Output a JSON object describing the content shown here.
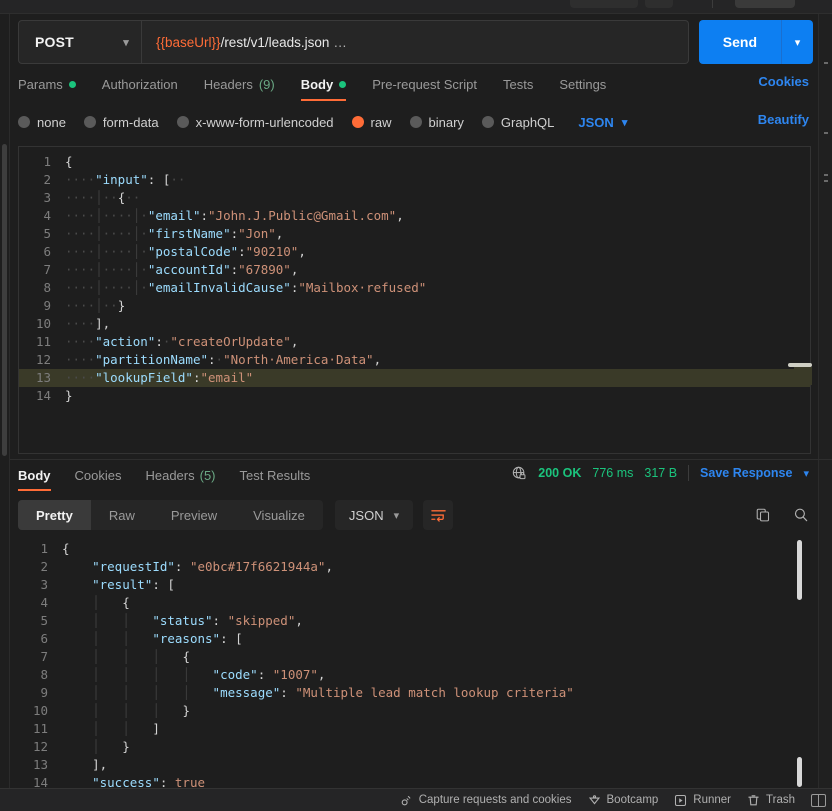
{
  "request": {
    "method": "POST",
    "url_variable": "{{baseUrl}}",
    "url_path": "/rest/v1/leads.json",
    "url_ellipsis": "…",
    "send_label": "Send",
    "tabs": [
      {
        "label": "Params",
        "dot": true,
        "active": false
      },
      {
        "label": "Authorization",
        "dot": false,
        "active": false
      },
      {
        "label": "Headers",
        "count": "(9)",
        "dot": false,
        "active": false
      },
      {
        "label": "Body",
        "dot": true,
        "active": true
      },
      {
        "label": "Pre-request Script",
        "dot": false,
        "active": false
      },
      {
        "label": "Tests",
        "dot": false,
        "active": false
      },
      {
        "label": "Settings",
        "dot": false,
        "active": false
      }
    ],
    "cookies_link": "Cookies",
    "body_types": [
      {
        "label": "none",
        "selected": false
      },
      {
        "label": "form-data",
        "selected": false
      },
      {
        "label": "x-www-form-urlencoded",
        "selected": false
      },
      {
        "label": "raw",
        "selected": true
      },
      {
        "label": "binary",
        "selected": false
      },
      {
        "label": "GraphQL",
        "selected": false
      }
    ],
    "language": "JSON",
    "beautify_label": "Beautify",
    "highlighted_line": 13,
    "code_lines": [
      {
        "n": 1,
        "segs": [
          {
            "t": "{",
            "c": "p"
          }
        ]
      },
      {
        "n": 2,
        "segs": [
          {
            "t": "····",
            "c": "ws"
          },
          {
            "t": "\"input\"",
            "c": "k"
          },
          {
            "t": ": [",
            "c": "p"
          },
          {
            "t": "··",
            "c": "ws"
          }
        ]
      },
      {
        "n": 3,
        "segs": [
          {
            "t": "····",
            "c": "ws"
          },
          {
            "t": "│",
            "c": "guide"
          },
          {
            "t": "··",
            "c": "ws"
          },
          {
            "t": "{",
            "c": "p"
          },
          {
            "t": "··",
            "c": "ws"
          }
        ]
      },
      {
        "n": 4,
        "segs": [
          {
            "t": "····",
            "c": "ws"
          },
          {
            "t": "│",
            "c": "guide"
          },
          {
            "t": "····",
            "c": "ws"
          },
          {
            "t": "│",
            "c": "guide"
          },
          {
            "t": "·",
            "c": "ws"
          },
          {
            "t": "\"email\"",
            "c": "k"
          },
          {
            "t": ":",
            "c": "p"
          },
          {
            "t": "\"John.J.Public@Gmail.com\"",
            "c": "s"
          },
          {
            "t": ",",
            "c": "p"
          }
        ]
      },
      {
        "n": 5,
        "segs": [
          {
            "t": "····",
            "c": "ws"
          },
          {
            "t": "│",
            "c": "guide"
          },
          {
            "t": "····",
            "c": "ws"
          },
          {
            "t": "│",
            "c": "guide"
          },
          {
            "t": "·",
            "c": "ws"
          },
          {
            "t": "\"firstName\"",
            "c": "k"
          },
          {
            "t": ":",
            "c": "p"
          },
          {
            "t": "\"Jon\"",
            "c": "s"
          },
          {
            "t": ",",
            "c": "p"
          }
        ]
      },
      {
        "n": 6,
        "segs": [
          {
            "t": "····",
            "c": "ws"
          },
          {
            "t": "│",
            "c": "guide"
          },
          {
            "t": "····",
            "c": "ws"
          },
          {
            "t": "│",
            "c": "guide"
          },
          {
            "t": "·",
            "c": "ws"
          },
          {
            "t": "\"postalCode\"",
            "c": "k"
          },
          {
            "t": ":",
            "c": "p"
          },
          {
            "t": "\"90210\"",
            "c": "s"
          },
          {
            "t": ",",
            "c": "p"
          }
        ]
      },
      {
        "n": 7,
        "segs": [
          {
            "t": "····",
            "c": "ws"
          },
          {
            "t": "│",
            "c": "guide"
          },
          {
            "t": "····",
            "c": "ws"
          },
          {
            "t": "│",
            "c": "guide"
          },
          {
            "t": "·",
            "c": "ws"
          },
          {
            "t": "\"accountId\"",
            "c": "k"
          },
          {
            "t": ":",
            "c": "p"
          },
          {
            "t": "\"67890\"",
            "c": "s"
          },
          {
            "t": ",",
            "c": "p"
          }
        ]
      },
      {
        "n": 8,
        "segs": [
          {
            "t": "····",
            "c": "ws"
          },
          {
            "t": "│",
            "c": "guide"
          },
          {
            "t": "····",
            "c": "ws"
          },
          {
            "t": "│",
            "c": "guide"
          },
          {
            "t": "·",
            "c": "ws"
          },
          {
            "t": "\"emailInvalidCause\"",
            "c": "k"
          },
          {
            "t": ":",
            "c": "p"
          },
          {
            "t": "\"Mailbox·refused\"",
            "c": "s"
          }
        ]
      },
      {
        "n": 9,
        "segs": [
          {
            "t": "····",
            "c": "ws"
          },
          {
            "t": "│",
            "c": "guide"
          },
          {
            "t": "··",
            "c": "ws"
          },
          {
            "t": "}",
            "c": "p"
          }
        ]
      },
      {
        "n": 10,
        "segs": [
          {
            "t": "····",
            "c": "ws"
          },
          {
            "t": "],",
            "c": "p"
          }
        ]
      },
      {
        "n": 11,
        "segs": [
          {
            "t": "····",
            "c": "ws"
          },
          {
            "t": "\"action\"",
            "c": "k"
          },
          {
            "t": ":",
            "c": "p"
          },
          {
            "t": "·",
            "c": "ws"
          },
          {
            "t": "\"createOrUpdate\"",
            "c": "s"
          },
          {
            "t": ",",
            "c": "p"
          }
        ]
      },
      {
        "n": 12,
        "segs": [
          {
            "t": "····",
            "c": "ws"
          },
          {
            "t": "\"partitionName\"",
            "c": "k"
          },
          {
            "t": ":",
            "c": "p"
          },
          {
            "t": "·",
            "c": "ws"
          },
          {
            "t": "\"North·America·Data\"",
            "c": "s"
          },
          {
            "t": ",",
            "c": "p"
          }
        ]
      },
      {
        "n": 13,
        "segs": [
          {
            "t": "····",
            "c": "ws"
          },
          {
            "t": "\"lookupField\"",
            "c": "k"
          },
          {
            "t": ":",
            "c": "p"
          },
          {
            "t": "\"email\"",
            "c": "s"
          }
        ]
      },
      {
        "n": 14,
        "segs": [
          {
            "t": "}",
            "c": "p"
          }
        ]
      }
    ]
  },
  "response": {
    "tabs": [
      {
        "label": "Body",
        "active": true
      },
      {
        "label": "Cookies",
        "active": false
      },
      {
        "label": "Headers",
        "count": "(5)",
        "active": false
      },
      {
        "label": "Test Results",
        "active": false
      }
    ],
    "status": "200 OK",
    "time": "776 ms",
    "size": "317 B",
    "save_label": "Save Response",
    "view_modes": [
      {
        "label": "Pretty",
        "active": true
      },
      {
        "label": "Raw",
        "active": false
      },
      {
        "label": "Preview",
        "active": false
      },
      {
        "label": "Visualize",
        "active": false
      }
    ],
    "format": "JSON",
    "code_lines": [
      {
        "n": 1,
        "segs": [
          {
            "t": "{",
            "c": "p"
          }
        ]
      },
      {
        "n": 2,
        "segs": [
          {
            "t": "    ",
            "c": "ws"
          },
          {
            "t": "\"requestId\"",
            "c": "k"
          },
          {
            "t": ": ",
            "c": "p"
          },
          {
            "t": "\"e0bc#17f6621944a\"",
            "c": "s"
          },
          {
            "t": ",",
            "c": "p"
          }
        ]
      },
      {
        "n": 3,
        "segs": [
          {
            "t": "    ",
            "c": "ws"
          },
          {
            "t": "\"result\"",
            "c": "k"
          },
          {
            "t": ": [",
            "c": "p"
          }
        ]
      },
      {
        "n": 4,
        "segs": [
          {
            "t": "    ",
            "c": "ws"
          },
          {
            "t": "│",
            "c": "guide"
          },
          {
            "t": "   ",
            "c": "ws"
          },
          {
            "t": "{",
            "c": "p"
          }
        ]
      },
      {
        "n": 5,
        "segs": [
          {
            "t": "    ",
            "c": "ws"
          },
          {
            "t": "│",
            "c": "guide"
          },
          {
            "t": "   ",
            "c": "ws"
          },
          {
            "t": "│",
            "c": "guide"
          },
          {
            "t": "   ",
            "c": "ws"
          },
          {
            "t": "\"status\"",
            "c": "k"
          },
          {
            "t": ": ",
            "c": "p"
          },
          {
            "t": "\"skipped\"",
            "c": "s"
          },
          {
            "t": ",",
            "c": "p"
          }
        ]
      },
      {
        "n": 6,
        "segs": [
          {
            "t": "    ",
            "c": "ws"
          },
          {
            "t": "│",
            "c": "guide"
          },
          {
            "t": "   ",
            "c": "ws"
          },
          {
            "t": "│",
            "c": "guide"
          },
          {
            "t": "   ",
            "c": "ws"
          },
          {
            "t": "\"reasons\"",
            "c": "k"
          },
          {
            "t": ": [",
            "c": "p"
          }
        ]
      },
      {
        "n": 7,
        "segs": [
          {
            "t": "    ",
            "c": "ws"
          },
          {
            "t": "│",
            "c": "guide"
          },
          {
            "t": "   ",
            "c": "ws"
          },
          {
            "t": "│",
            "c": "guide"
          },
          {
            "t": "   ",
            "c": "ws"
          },
          {
            "t": "│",
            "c": "guide"
          },
          {
            "t": "   ",
            "c": "ws"
          },
          {
            "t": "{",
            "c": "p"
          }
        ]
      },
      {
        "n": 8,
        "segs": [
          {
            "t": "    ",
            "c": "ws"
          },
          {
            "t": "│",
            "c": "guide"
          },
          {
            "t": "   ",
            "c": "ws"
          },
          {
            "t": "│",
            "c": "guide"
          },
          {
            "t": "   ",
            "c": "ws"
          },
          {
            "t": "│",
            "c": "guide"
          },
          {
            "t": "   ",
            "c": "ws"
          },
          {
            "t": "│",
            "c": "guide"
          },
          {
            "t": "   ",
            "c": "ws"
          },
          {
            "t": "\"code\"",
            "c": "k"
          },
          {
            "t": ": ",
            "c": "p"
          },
          {
            "t": "\"1007\"",
            "c": "s"
          },
          {
            "t": ",",
            "c": "p"
          }
        ]
      },
      {
        "n": 9,
        "segs": [
          {
            "t": "    ",
            "c": "ws"
          },
          {
            "t": "│",
            "c": "guide"
          },
          {
            "t": "   ",
            "c": "ws"
          },
          {
            "t": "│",
            "c": "guide"
          },
          {
            "t": "   ",
            "c": "ws"
          },
          {
            "t": "│",
            "c": "guide"
          },
          {
            "t": "   ",
            "c": "ws"
          },
          {
            "t": "│",
            "c": "guide"
          },
          {
            "t": "   ",
            "c": "ws"
          },
          {
            "t": "\"message\"",
            "c": "k"
          },
          {
            "t": ": ",
            "c": "p"
          },
          {
            "t": "\"Multiple lead match lookup criteria\"",
            "c": "s"
          }
        ]
      },
      {
        "n": 10,
        "segs": [
          {
            "t": "    ",
            "c": "ws"
          },
          {
            "t": "│",
            "c": "guide"
          },
          {
            "t": "   ",
            "c": "ws"
          },
          {
            "t": "│",
            "c": "guide"
          },
          {
            "t": "   ",
            "c": "ws"
          },
          {
            "t": "│",
            "c": "guide"
          },
          {
            "t": "   ",
            "c": "ws"
          },
          {
            "t": "}",
            "c": "p"
          }
        ]
      },
      {
        "n": 11,
        "segs": [
          {
            "t": "    ",
            "c": "ws"
          },
          {
            "t": "│",
            "c": "guide"
          },
          {
            "t": "   ",
            "c": "ws"
          },
          {
            "t": "│",
            "c": "guide"
          },
          {
            "t": "   ",
            "c": "ws"
          },
          {
            "t": "]",
            "c": "p"
          }
        ]
      },
      {
        "n": 12,
        "segs": [
          {
            "t": "    ",
            "c": "ws"
          },
          {
            "t": "│",
            "c": "guide"
          },
          {
            "t": "   ",
            "c": "ws"
          },
          {
            "t": "}",
            "c": "p"
          }
        ]
      },
      {
        "n": 13,
        "segs": [
          {
            "t": "    ",
            "c": "ws"
          },
          {
            "t": "],",
            "c": "p"
          }
        ]
      },
      {
        "n": 14,
        "segs": [
          {
            "t": "    ",
            "c": "ws"
          },
          {
            "t": "\"success\"",
            "c": "k"
          },
          {
            "t": ": ",
            "c": "p"
          },
          {
            "t": "true",
            "c": "s"
          }
        ]
      }
    ]
  },
  "statusbar": {
    "items": [
      {
        "label": "Capture requests and cookies",
        "icon": "satellite-icon"
      },
      {
        "label": "Bootcamp",
        "icon": "bootcamp-icon"
      },
      {
        "label": "Runner",
        "icon": "runner-icon"
      },
      {
        "label": "Trash",
        "icon": "trash-icon"
      }
    ],
    "layout_toggle": "layout-toggle-icon"
  },
  "colors": {
    "accent": "#ff6c37",
    "link": "#2e86f0",
    "send": "#0d7ff2",
    "success": "#1bc47d",
    "bg": "#1e1e1e"
  }
}
